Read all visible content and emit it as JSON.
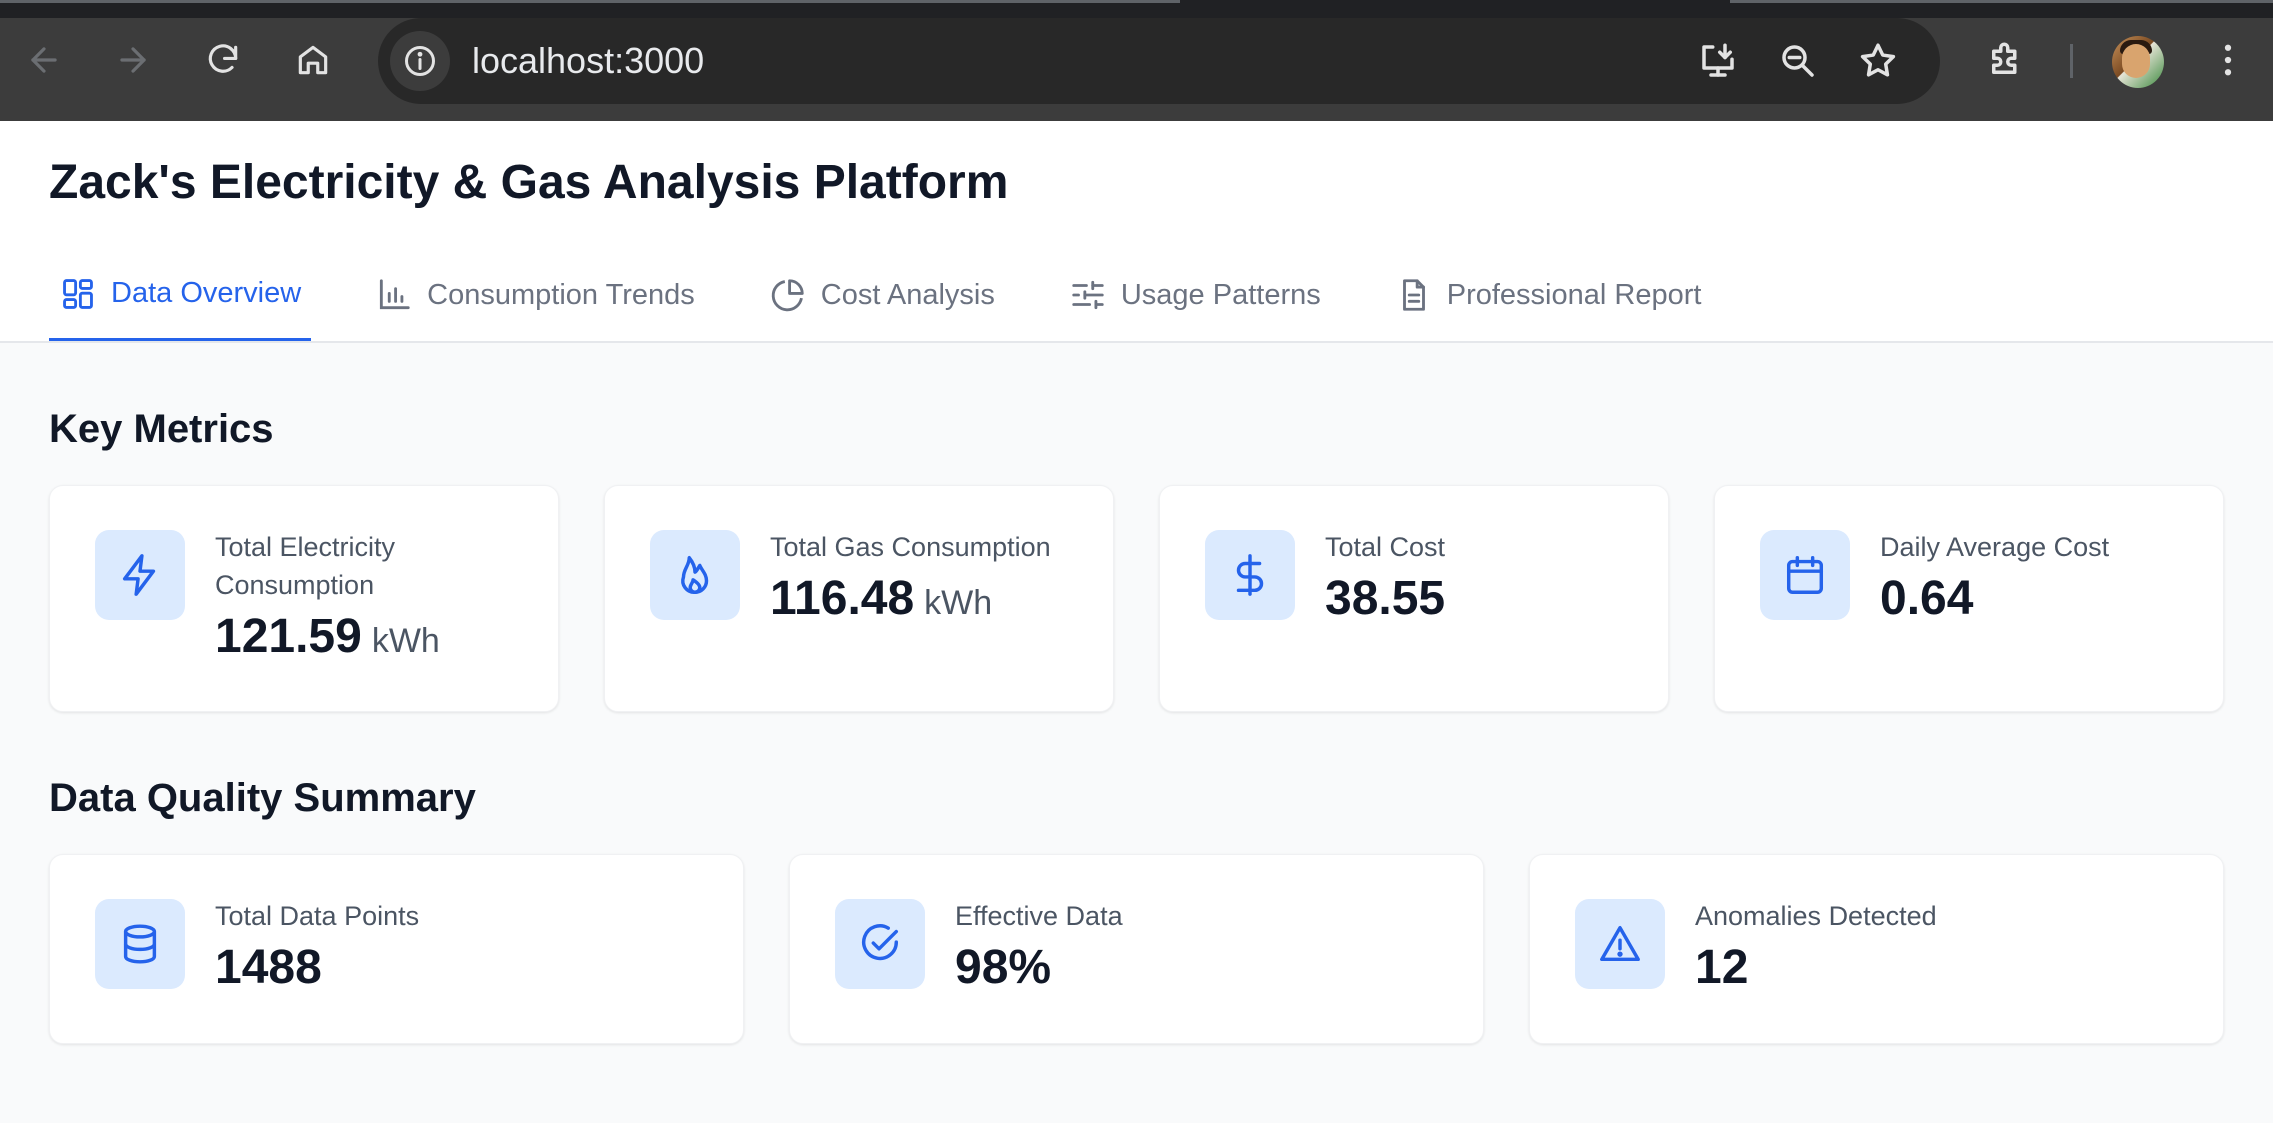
{
  "browser": {
    "url": "localhost:3000",
    "icons": [
      "back-icon",
      "forward-icon",
      "reload-icon",
      "home-icon",
      "site-info-icon",
      "install-app-icon",
      "zoom-out-icon",
      "bookmark-star-icon",
      "extensions-icon",
      "more-menu-icon"
    ]
  },
  "app": {
    "title": "Zack's Electricity & Gas Analysis Platform",
    "accent_color": "#2563eb",
    "tabs": [
      {
        "label": "Data Overview",
        "icon": "grid-icon",
        "active": true
      },
      {
        "label": "Consumption Trends",
        "icon": "bar-chart-icon",
        "active": false
      },
      {
        "label": "Cost Analysis",
        "icon": "pie-chart-icon",
        "active": false
      },
      {
        "label": "Usage Patterns",
        "icon": "sliders-icon",
        "active": false
      },
      {
        "label": "Professional Report",
        "icon": "document-icon",
        "active": false
      }
    ]
  },
  "key_metrics": {
    "title": "Key Metrics",
    "cards": [
      {
        "label": "Total Electricity Consumption",
        "value": "121.59",
        "unit": "kWh",
        "icon": "lightning-icon"
      },
      {
        "label": "Total Gas Consumption",
        "value": "116.48",
        "unit": "kWh",
        "icon": "flame-icon"
      },
      {
        "label": "Total Cost",
        "value": "38.55",
        "unit": "",
        "icon": "dollar-icon"
      },
      {
        "label": "Daily Average Cost",
        "value": "0.64",
        "unit": "",
        "icon": "calendar-icon"
      }
    ]
  },
  "data_quality": {
    "title": "Data Quality Summary",
    "cards": [
      {
        "label": "Total Data Points",
        "value": "1488",
        "icon": "database-icon"
      },
      {
        "label": "Effective Data",
        "value": "98%",
        "icon": "check-circle-icon"
      },
      {
        "label": "Anomalies Detected",
        "value": "12",
        "icon": "warning-icon"
      }
    ]
  }
}
